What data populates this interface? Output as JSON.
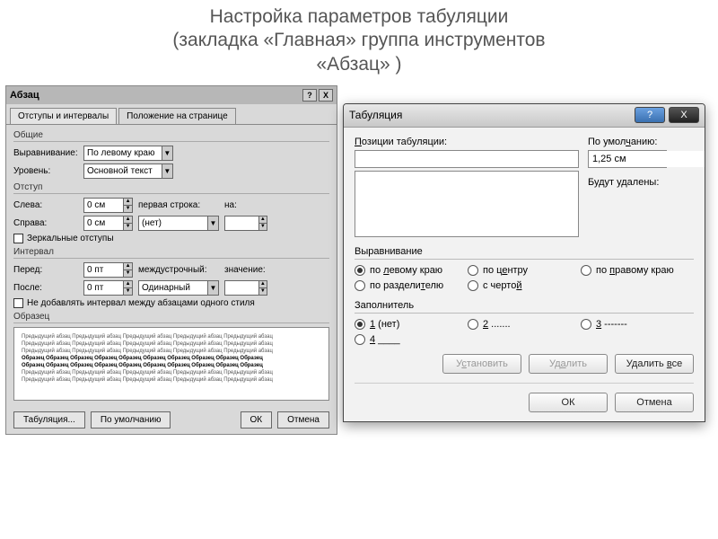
{
  "header": {
    "line1": "Настройка параметров табуляции",
    "line2": "(закладка «Главная» группа инструментов",
    "line3": "«Абзац» )"
  },
  "left": {
    "title": "Абзац",
    "tabs": [
      "Отступы и интервалы",
      "Положение на странице"
    ],
    "general": {
      "legend": "Общие",
      "align_label": "Выравнивание:",
      "align_value": "По левому краю",
      "level_label": "Уровень:",
      "level_value": "Основной текст"
    },
    "indent": {
      "legend": "Отступ",
      "left_label": "Слева:",
      "left_value": "0 см",
      "right_label": "Справа:",
      "right_value": "0 см",
      "firstline_label": "первая строка:",
      "firstline_value": "(нет)",
      "by_label": "на:",
      "by_value": "",
      "mirror": "Зеркальные отступы"
    },
    "spacing": {
      "legend": "Интервал",
      "before_label": "Перед:",
      "before_value": "0 пт",
      "after_label": "После:",
      "after_value": "0 пт",
      "line_label": "междустрочный:",
      "line_value": "Одинарный",
      "line_at_label": "значение:",
      "line_at_value": "",
      "dontadd": "Не добавлять интервал между абзацами одного стиля"
    },
    "preview": {
      "legend": "Образец",
      "faint": "Предыдущий абзац Предыдущий абзац Предыдущий абзац Предыдущий абзац Предыдущий абзац",
      "bold": "Образец Образец Образец Образец Образец Образец Образец Образец Образец Образец"
    },
    "buttons": {
      "tabs": "Табуляция...",
      "default": "По умолчанию",
      "ok": "ОК",
      "cancel": "Отмена"
    }
  },
  "right": {
    "title": "Табуляция",
    "positions_label": "Позиции табуляции:",
    "positions_value": "",
    "default_label": "По умолчанию:",
    "default_value": "1,25 см",
    "cleared_label": "Будут удалены:",
    "align": {
      "legend": "Выравнивание",
      "left": "по левому краю",
      "center": "по центру",
      "right": "по правому краю",
      "decimal": "по разделителю",
      "bar": "с чертой"
    },
    "leader": {
      "legend": "Заполнитель",
      "opt1": "1 (нет)",
      "opt2": "2 .......",
      "opt3": "3 -------",
      "opt4": "4 ____"
    },
    "buttons": {
      "set": "Установить",
      "clear": "Удалить",
      "clear_all": "Удалить все",
      "ok": "ОК",
      "cancel": "Отмена"
    }
  }
}
